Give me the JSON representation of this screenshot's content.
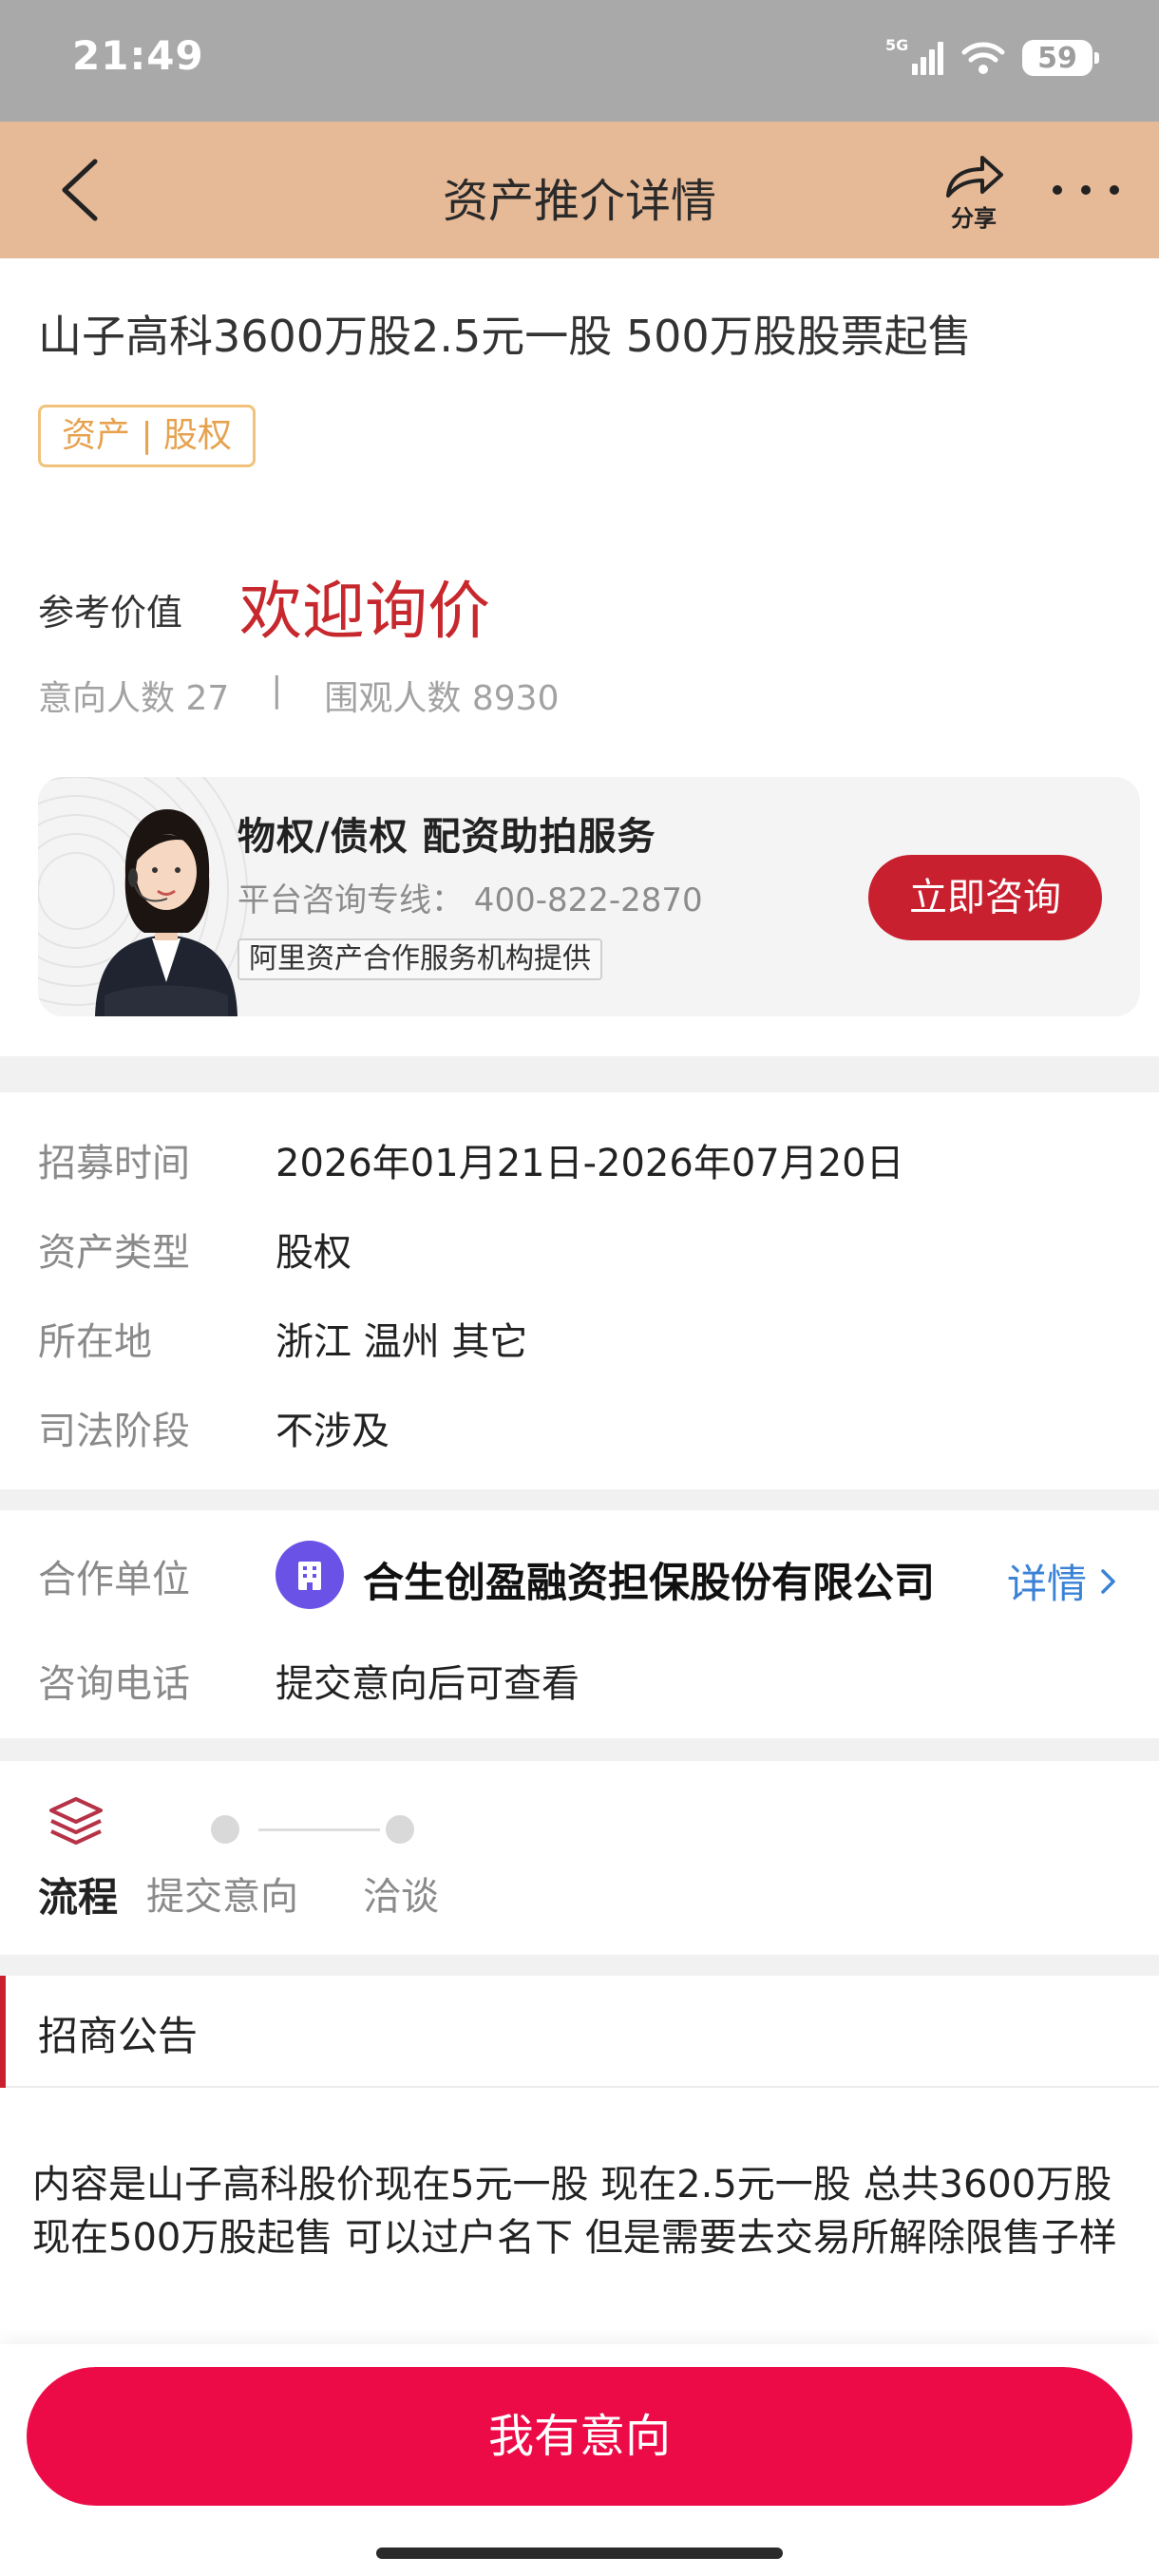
{
  "status_bar": {
    "time": "21:49",
    "network": "5G",
    "battery": "59"
  },
  "nav": {
    "title": "资产推介详情",
    "share_label": "分享"
  },
  "asset": {
    "title": "山子高科3600万股2.5元一股 500万股股票起售",
    "tag": "资产 | 股权",
    "ref_label": "参考价值",
    "ref_value": "欢迎询价",
    "intent_count": "意向人数 27",
    "stats_separator": "|",
    "view_count": "围观人数 8930"
  },
  "promo": {
    "title": "物权/债权  配资助拍服务",
    "phone": "平台咨询专线： 400-822-2870",
    "badge": "阿里资产合作服务机构提供",
    "button": "立即咨询"
  },
  "info": [
    {
      "label": "招募时间",
      "value": "2026年01月21日-2026年07月20日"
    },
    {
      "label": "资产类型",
      "value": "股权"
    },
    {
      "label": "所在地",
      "value": "浙江 温州 其它"
    },
    {
      "label": "司法阶段",
      "value": "不涉及"
    }
  ],
  "partner": {
    "label": "合作单位",
    "name": "合生创盈融资担保股份有限公司",
    "detail": "详情",
    "phone_label": "咨询电话",
    "phone_value": "提交意向后可查看"
  },
  "flow": {
    "label": "流程",
    "steps": [
      "提交意向",
      "洽谈"
    ]
  },
  "notice": {
    "title": "招商公告",
    "content": "内容是山子高科股价现在5元一股 现在2.5元一股  总共3600万股 现在500万股起售 可以过户名下 但是需要去交易所解除限售子样"
  },
  "cta": {
    "label": "我有意向"
  },
  "colors": {
    "nav_bg": "#e6b997",
    "accent_red": "#c8202f",
    "cta": "#ec0a47",
    "tag": "#e6a24f",
    "link": "#3b82d6"
  }
}
